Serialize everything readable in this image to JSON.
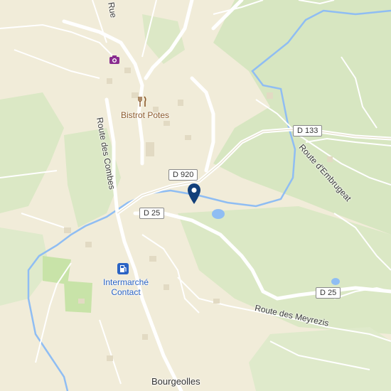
{
  "map": {
    "roads": [
      "Route des Combes",
      "Route d'Embrugeat",
      "Route des Meyrezis",
      "Rue"
    ],
    "shields": [
      "D 920",
      "D 133",
      "D 25",
      "D 25"
    ],
    "pois": {
      "restaurant": "Bistrot Potes",
      "supermarket": "Intermarché Contact"
    },
    "places": {
      "village": "Bourgeolles"
    },
    "icons": {
      "camera": "camera-icon",
      "restaurant": "fork-knife-icon",
      "fuel": "fuel-pump-icon",
      "marker": "map-pin-icon"
    },
    "colors": {
      "land": "#f1ecd9",
      "forest": "#d5e4bd",
      "water": "#8fbdf3",
      "road": "#ffffff",
      "poi_brown": "#8b5a2b",
      "poi_blue": "#2a63c4",
      "camera_purple": "#8a2c8f",
      "marker": "#123f7a"
    }
  }
}
